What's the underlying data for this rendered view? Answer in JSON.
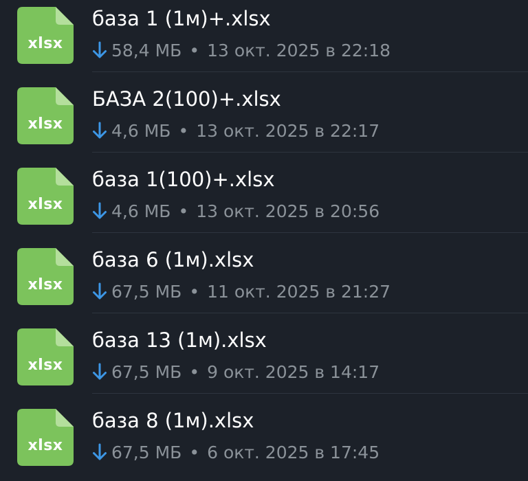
{
  "colors": {
    "background": "#1c2129",
    "file_icon_green": "#7cc35c",
    "file_icon_fold": "#b4df9c",
    "title_text": "#ffffff",
    "meta_text": "#8b9299",
    "download_arrow": "#3d97e6"
  },
  "icons": {
    "file": "xlsx-file-icon",
    "download": "download-arrow-icon"
  },
  "separator": "•",
  "files": [
    {
      "ext": "xlsx",
      "name": "база 1 (1м)+.xlsx",
      "size": "58,4 МБ",
      "date": "13 окт. 2025 в 22:18"
    },
    {
      "ext": "xlsx",
      "name": "БАЗА 2(100)+.xlsx",
      "size": "4,6 МБ",
      "date": "13 окт. 2025 в 22:17"
    },
    {
      "ext": "xlsx",
      "name": "база 1(100)+.xlsx",
      "size": "4,6 МБ",
      "date": "13 окт. 2025 в 20:56"
    },
    {
      "ext": "xlsx",
      "name": "база 6 (1м).xlsx",
      "size": "67,5 МБ",
      "date": "11 окт. 2025 в 21:27"
    },
    {
      "ext": "xlsx",
      "name": "база 13 (1м).xlsx",
      "size": "67,5 МБ",
      "date": "9 окт. 2025 в 14:17"
    },
    {
      "ext": "xlsx",
      "name": "база 8 (1м).xlsx",
      "size": "67,5 МБ",
      "date": "6 окт. 2025 в 17:45"
    }
  ]
}
